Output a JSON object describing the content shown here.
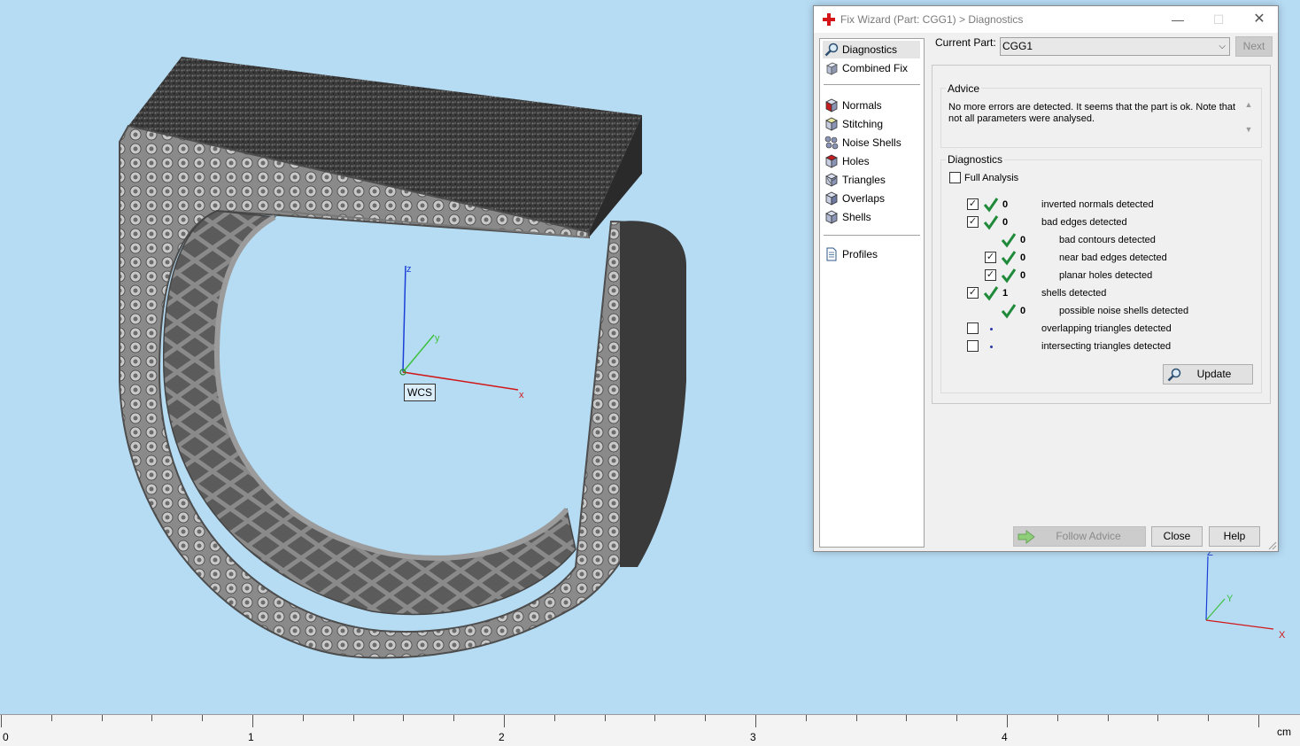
{
  "viewport": {
    "wcs_label": "WCS",
    "axes": {
      "x": "x",
      "y": "y",
      "z": "z"
    },
    "mini_axes": {
      "x": "X",
      "y": "Y",
      "z": "Z"
    },
    "model_name": "CGG1"
  },
  "ruler": {
    "numbers": [
      "0",
      "1",
      "2",
      "3",
      "4"
    ],
    "unit": "cm"
  },
  "dialog": {
    "title": "Fix Wizard (Part: CGG1) > Diagnostics",
    "nav": {
      "top": [
        "Diagnostics",
        "Combined Fix"
      ],
      "tools": [
        "Normals",
        "Stitching",
        "Noise Shells",
        "Holes",
        "Triangles",
        "Overlaps",
        "Shells"
      ],
      "bottom": [
        "Profiles"
      ]
    },
    "current_part_label": "Current Part:",
    "current_part_value": "CGG1",
    "next_label": "Next",
    "advice_title": "Advice",
    "advice_text": "No more errors are detected. It seems that the part is ok. Note that not all parameters were analysed.",
    "diagnostics_title": "Diagnostics",
    "full_analysis_label": "Full Analysis",
    "full_analysis_checked": false,
    "rows": [
      {
        "checked": true,
        "ok": true,
        "count": "0",
        "label": "inverted normals detected"
      },
      {
        "checked": true,
        "ok": true,
        "count": "0",
        "label": "bad edges detected"
      },
      {
        "checked": null,
        "ok": true,
        "count": "0",
        "label": "bad contours detected"
      },
      {
        "checked": true,
        "ok": true,
        "count": "0",
        "label": "near bad edges detected"
      },
      {
        "checked": true,
        "ok": true,
        "count": "0",
        "label": "planar holes detected"
      },
      {
        "checked": true,
        "ok": true,
        "count": "1",
        "label": "shells detected"
      },
      {
        "checked": null,
        "ok": true,
        "count": "0",
        "label": "possible noise shells detected"
      },
      {
        "checked": false,
        "ok": false,
        "count": "",
        "label": "overlapping triangles detected"
      },
      {
        "checked": false,
        "ok": false,
        "count": "",
        "label": "intersecting triangles detected"
      }
    ],
    "update_label": "Update",
    "follow_advice_label": "Follow Advice",
    "close_label": "Close",
    "help_label": "Help"
  },
  "colors": {
    "background": "#b6dcf4",
    "model": "#8f8f8f",
    "check_green": "#1f8a3a",
    "x_axis": "#d01818",
    "y_axis": "#3cc03c",
    "z_axis": "#1a3fd8"
  }
}
